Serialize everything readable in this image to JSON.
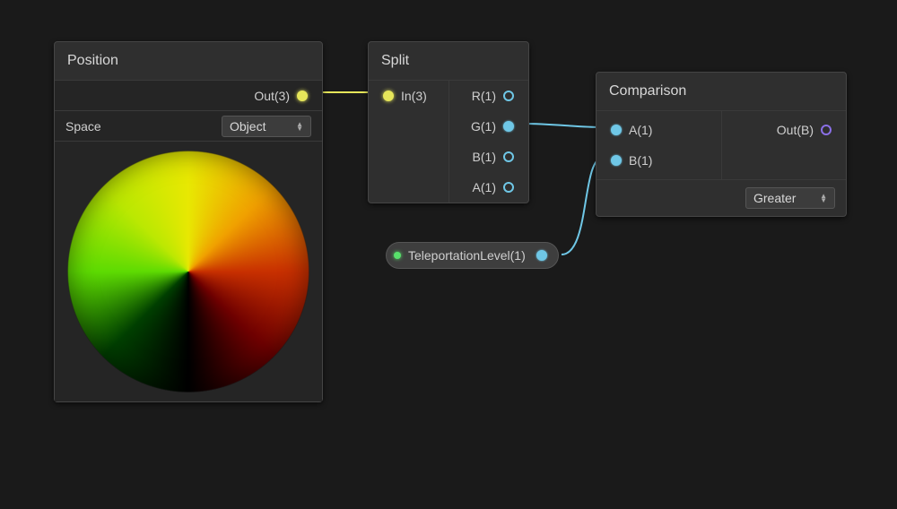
{
  "position_node": {
    "title": "Position",
    "out_label": "Out(3)",
    "space_label": "Space",
    "space_value": "Object"
  },
  "split_node": {
    "title": "Split",
    "in_label": "In(3)",
    "r_label": "R(1)",
    "g_label": "G(1)",
    "b_label": "B(1)",
    "a_label": "A(1)"
  },
  "comparison_node": {
    "title": "Comparison",
    "a_label": "A(1)",
    "b_label": "B(1)",
    "out_label": "Out(B)",
    "mode_value": "Greater"
  },
  "variable_node": {
    "label": "TeleportationLevel(1)"
  },
  "wires": {
    "position_out_to_split_in": {
      "from": "position.out",
      "to": "split.in",
      "color": "yellow"
    },
    "split_g_to_comparison_a": {
      "from": "split.g",
      "to": "comparison.a",
      "color": "cyan"
    },
    "teleport_to_comparison_b": {
      "from": "teleport.out",
      "to": "comparison.b",
      "color": "cyan"
    }
  }
}
